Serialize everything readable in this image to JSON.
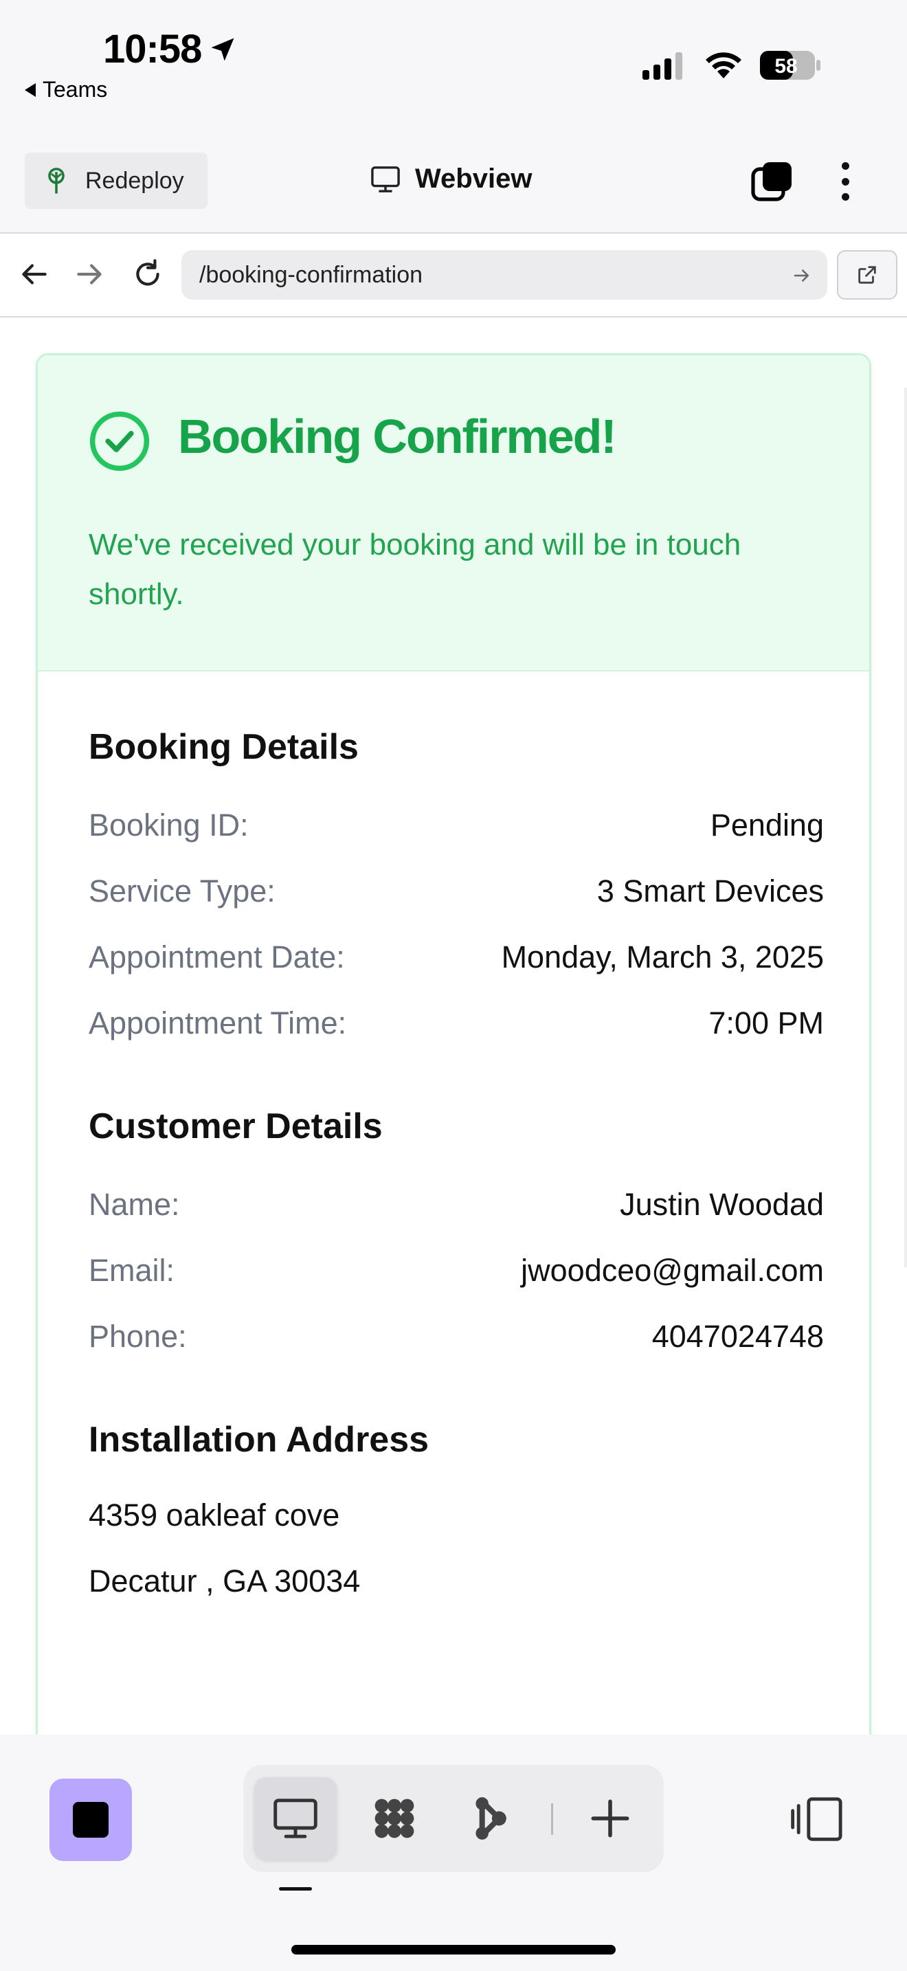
{
  "status_bar": {
    "time": "10:58",
    "back_app": "Teams",
    "battery": "58"
  },
  "top_bar": {
    "redeploy_label": "Redeploy",
    "title": "Webview"
  },
  "url_bar": {
    "url": "/booking-confirmation"
  },
  "confirmation": {
    "title": "Booking Confirmed!",
    "message": "We've received your booking and will be in touch shortly."
  },
  "booking_details": {
    "heading": "Booking Details",
    "rows": [
      {
        "label": "Booking ID:",
        "value": "Pending"
      },
      {
        "label": "Service Type:",
        "value": "3 Smart Devices"
      },
      {
        "label": "Appointment Date:",
        "value": "Monday, March 3, 2025"
      },
      {
        "label": "Appointment Time:",
        "value": "7:00 PM"
      }
    ]
  },
  "customer_details": {
    "heading": "Customer Details",
    "rows": [
      {
        "label": "Name:",
        "value": "Justin Woodad"
      },
      {
        "label": "Email:",
        "value": "jwoodceo@gmail.com"
      },
      {
        "label": "Phone:",
        "value": "4047024748"
      }
    ]
  },
  "installation_address": {
    "heading": "Installation Address",
    "line1": "4359 oakleaf cove",
    "line2": "Decatur , GA 30034"
  },
  "colors": {
    "success_green": "#16a34a",
    "success_bg": "#eafbf0",
    "stop_button": "#b9a6ff"
  },
  "icons": {
    "toolbar": [
      "monitor-icon",
      "apps-grid-icon",
      "agent-icon",
      "plus-icon"
    ],
    "panel": "panel-toggle-icon"
  }
}
